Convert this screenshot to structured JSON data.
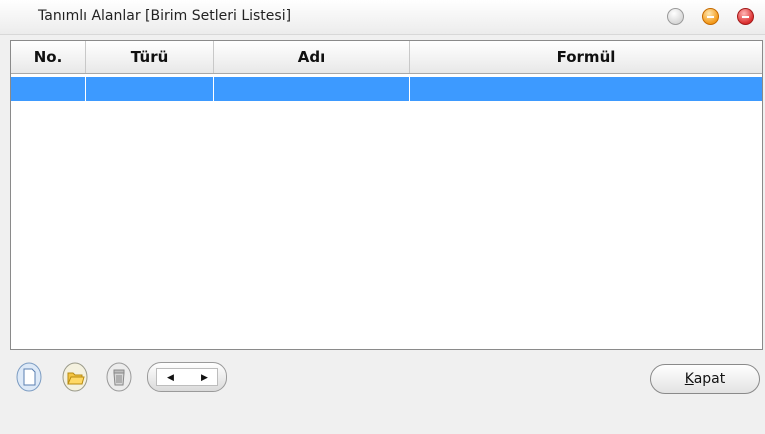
{
  "window": {
    "title": "Tanımlı Alanlar [Birim Setleri Listesi]"
  },
  "grid": {
    "columns": [
      "No.",
      "Türü",
      "Adı",
      "Formül"
    ],
    "rows": [
      {
        "no": "",
        "turu": "",
        "adi": "",
        "formul": ""
      }
    ],
    "selected_row_color": "#3d9aff"
  },
  "toolbar": {
    "icons": [
      "new-document-icon",
      "open-folder-icon",
      "trash-icon",
      "scroll-arrows-control"
    ]
  },
  "buttons": {
    "close_label_prefix": "K",
    "close_label_rest": "apat"
  }
}
